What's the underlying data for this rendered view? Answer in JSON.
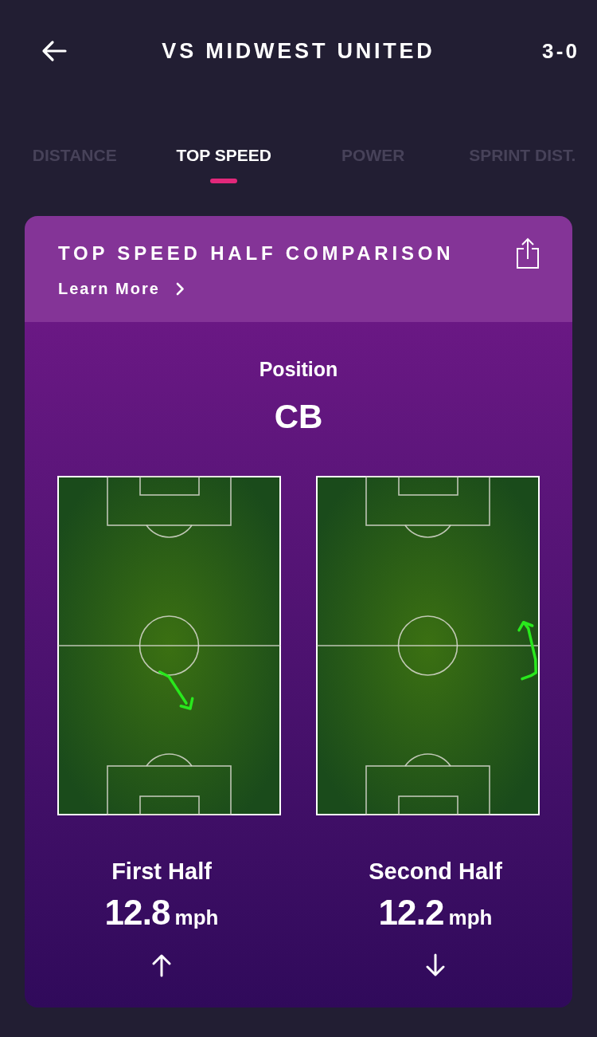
{
  "header": {
    "title": "VS MIDWEST UNITED",
    "score": "3-0"
  },
  "tabs": [
    {
      "label": "DISTANCE",
      "selected": false
    },
    {
      "label": "TOP SPEED",
      "selected": true
    },
    {
      "label": "POWER",
      "selected": false
    },
    {
      "label": "SPRINT DIST.",
      "selected": false
    }
  ],
  "card": {
    "title": "TOP SPEED HALF COMPARISON",
    "link": "Learn More",
    "position_label": "Position",
    "position": "CB",
    "halves": [
      {
        "label": "First Half",
        "value": "12.8",
        "unit": "mph",
        "kind": "up"
      },
      {
        "label": "Second Half",
        "value": "12.2",
        "unit": "mph",
        "kind": "down"
      }
    ]
  }
}
